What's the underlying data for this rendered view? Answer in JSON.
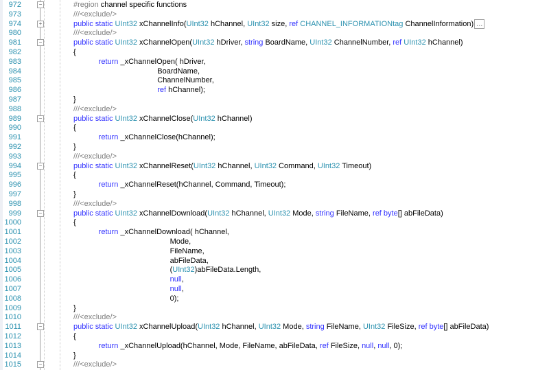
{
  "colors": {
    "keyword": "#3030ff",
    "type": "#2b91af",
    "comment": "#808080",
    "line_number": "#2b91af"
  },
  "lines": [
    {
      "n": "972",
      "fold": "minus",
      "t": [
        [
          "cm",
          "#region "
        ],
        [
          "tx",
          "channel specific functions"
        ]
      ]
    },
    {
      "n": "973",
      "t": [
        [
          "cm",
          "///<exclude/>"
        ]
      ]
    },
    {
      "n": "974",
      "fold": "plus",
      "t": [
        [
          "kw",
          "public static "
        ],
        [
          "ty",
          "UInt32"
        ],
        [
          "tx",
          " xChannelInfo("
        ],
        [
          "ty",
          "UInt32"
        ],
        [
          "tx",
          " hChannel, "
        ],
        [
          "ty",
          "UInt32"
        ],
        [
          "tx",
          " size, "
        ],
        [
          "kw",
          "ref "
        ],
        [
          "ty",
          "CHANNEL_INFORMATIONtag"
        ],
        [
          "tx",
          " ChannelInformation)"
        ],
        [
          "collapsed",
          "..."
        ]
      ]
    },
    {
      "n": "980",
      "t": [
        [
          "cm",
          "///<exclude/>"
        ]
      ]
    },
    {
      "n": "981",
      "fold": "minus",
      "t": [
        [
          "kw",
          "public static "
        ],
        [
          "ty",
          "UInt32"
        ],
        [
          "tx",
          " xChannelOpen("
        ],
        [
          "ty",
          "UInt32"
        ],
        [
          "tx",
          " hDriver, "
        ],
        [
          "kw",
          "string"
        ],
        [
          "tx",
          " BoardName, "
        ],
        [
          "ty",
          "UInt32"
        ],
        [
          "tx",
          " ChannelNumber, "
        ],
        [
          "kw",
          "ref "
        ],
        [
          "ty",
          "UInt32"
        ],
        [
          "tx",
          " hChannel)"
        ]
      ]
    },
    {
      "n": "982",
      "t": [
        [
          "tx",
          "{"
        ]
      ]
    },
    {
      "n": "983",
      "t": [
        [
          "kw",
          "            return"
        ],
        [
          "tx",
          " _xChannelOpen( hDriver,"
        ]
      ]
    },
    {
      "n": "984",
      "t": [
        [
          "tx",
          "                                        BoardName,"
        ]
      ]
    },
    {
      "n": "985",
      "t": [
        [
          "tx",
          "                                        ChannelNumber,"
        ]
      ]
    },
    {
      "n": "986",
      "t": [
        [
          "kw",
          "                                        ref"
        ],
        [
          "tx",
          " hChannel);"
        ]
      ]
    },
    {
      "n": "987",
      "t": [
        [
          "tx",
          "}"
        ]
      ]
    },
    {
      "n": "988",
      "t": [
        [
          "cm",
          "///<exclude/>"
        ]
      ]
    },
    {
      "n": "989",
      "fold": "minus",
      "t": [
        [
          "kw",
          "public static "
        ],
        [
          "ty",
          "UInt32"
        ],
        [
          "tx",
          " xChannelClose("
        ],
        [
          "ty",
          "UInt32"
        ],
        [
          "tx",
          " hChannel)"
        ]
      ]
    },
    {
      "n": "990",
      "t": [
        [
          "tx",
          "{"
        ]
      ]
    },
    {
      "n": "991",
      "t": [
        [
          "kw",
          "            return"
        ],
        [
          "tx",
          " _xChannelClose(hChannel);"
        ]
      ]
    },
    {
      "n": "992",
      "t": [
        [
          "tx",
          "}"
        ]
      ]
    },
    {
      "n": "993",
      "t": [
        [
          "cm",
          "///<exclude/>"
        ]
      ]
    },
    {
      "n": "994",
      "fold": "minus",
      "t": [
        [
          "kw",
          "public static "
        ],
        [
          "ty",
          "UInt32"
        ],
        [
          "tx",
          " xChannelReset("
        ],
        [
          "ty",
          "UInt32"
        ],
        [
          "tx",
          " hChannel, "
        ],
        [
          "ty",
          "UInt32"
        ],
        [
          "tx",
          " Command, "
        ],
        [
          "ty",
          "UInt32"
        ],
        [
          "tx",
          " Timeout)"
        ]
      ]
    },
    {
      "n": "995",
      "t": [
        [
          "tx",
          "{"
        ]
      ]
    },
    {
      "n": "996",
      "t": [
        [
          "kw",
          "            return"
        ],
        [
          "tx",
          " _xChannelReset(hChannel, Command, Timeout);"
        ]
      ]
    },
    {
      "n": "997",
      "t": [
        [
          "tx",
          "}"
        ]
      ]
    },
    {
      "n": "998",
      "t": [
        [
          "cm",
          "///<exclude/>"
        ]
      ]
    },
    {
      "n": "999",
      "fold": "minus",
      "t": [
        [
          "kw",
          "public static "
        ],
        [
          "ty",
          "UInt32"
        ],
        [
          "tx",
          " xChannelDownload("
        ],
        [
          "ty",
          "UInt32"
        ],
        [
          "tx",
          " hChannel, "
        ],
        [
          "ty",
          "UInt32"
        ],
        [
          "tx",
          " Mode, "
        ],
        [
          "kw",
          "string"
        ],
        [
          "tx",
          " FileName, "
        ],
        [
          "kw",
          "ref byte"
        ],
        [
          "tx",
          "[] abFileData)"
        ]
      ]
    },
    {
      "n": "1000",
      "t": [
        [
          "tx",
          "{"
        ]
      ]
    },
    {
      "n": "1001",
      "t": [
        [
          "kw",
          "            return"
        ],
        [
          "tx",
          " _xChannelDownload( hChannel,"
        ]
      ]
    },
    {
      "n": "1002",
      "t": [
        [
          "tx",
          "                                              Mode,"
        ]
      ]
    },
    {
      "n": "1003",
      "t": [
        [
          "tx",
          "                                              FileName,"
        ]
      ]
    },
    {
      "n": "1004",
      "t": [
        [
          "tx",
          "                                              abFileData,"
        ]
      ]
    },
    {
      "n": "1005",
      "t": [
        [
          "tx",
          "                                              ("
        ],
        [
          "ty",
          "UInt32"
        ],
        [
          "tx",
          ")abFileData.Length,"
        ]
      ]
    },
    {
      "n": "1006",
      "t": [
        [
          "kw",
          "                                              null"
        ],
        [
          "tx",
          ","
        ]
      ]
    },
    {
      "n": "1007",
      "t": [
        [
          "kw",
          "                                              null"
        ],
        [
          "tx",
          ","
        ]
      ]
    },
    {
      "n": "1008",
      "t": [
        [
          "tx",
          "                                              0);"
        ]
      ]
    },
    {
      "n": "1009",
      "t": [
        [
          "tx",
          "}"
        ]
      ]
    },
    {
      "n": "1010",
      "t": [
        [
          "cm",
          "///<exclude/>"
        ]
      ]
    },
    {
      "n": "1011",
      "fold": "minus",
      "t": [
        [
          "kw",
          "public static "
        ],
        [
          "ty",
          "UInt32"
        ],
        [
          "tx",
          " xChannelUpload("
        ],
        [
          "ty",
          "UInt32"
        ],
        [
          "tx",
          " hChannel, "
        ],
        [
          "ty",
          "UInt32"
        ],
        [
          "tx",
          " Mode, "
        ],
        [
          "kw",
          "string"
        ],
        [
          "tx",
          " FileName, "
        ],
        [
          "ty",
          "UInt32"
        ],
        [
          "tx",
          " FileSize, "
        ],
        [
          "kw",
          "ref byte"
        ],
        [
          "tx",
          "[] abFileData)"
        ]
      ]
    },
    {
      "n": "1012",
      "t": [
        [
          "tx",
          "{"
        ]
      ]
    },
    {
      "n": "1013",
      "t": [
        [
          "kw",
          "            return"
        ],
        [
          "tx",
          " _xChannelUpload(hChannel, Mode, FileName, abFileData, "
        ],
        [
          "kw",
          "ref"
        ],
        [
          "tx",
          " FileSize, "
        ],
        [
          "kw",
          "null"
        ],
        [
          "tx",
          ", "
        ],
        [
          "kw",
          "null"
        ],
        [
          "tx",
          ", 0);"
        ]
      ]
    },
    {
      "n": "1014",
      "t": [
        [
          "tx",
          "}"
        ]
      ]
    },
    {
      "n": "1015",
      "fold": "minus",
      "t": [
        [
          "cm",
          "///<exclude/>"
        ]
      ]
    }
  ]
}
